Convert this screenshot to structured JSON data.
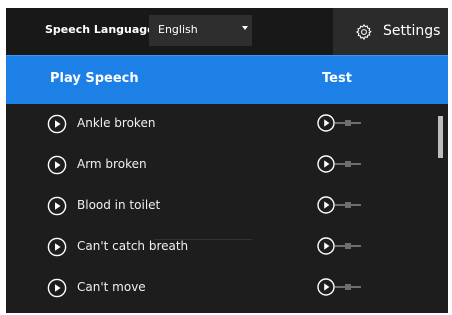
{
  "topbar": {
    "language_label": "Speech Language",
    "language_value": "English",
    "settings_label": "Settings"
  },
  "header": {
    "play_label": "Play Speech",
    "test_label": "Test"
  },
  "phrases": [
    {
      "label": "Ankle broken"
    },
    {
      "label": "Arm broken"
    },
    {
      "label": "Blood in toilet"
    },
    {
      "label": "Can't catch breath"
    },
    {
      "label": "Can't move"
    }
  ],
  "icons": {
    "settings": "gear-icon",
    "play": "play-circle-icon",
    "test": "play-with-slider-icon",
    "dropdown": "chevron-down-icon"
  },
  "colors": {
    "accent": "#1c80e6",
    "background": "#1d1d1d",
    "topbar": "#181818",
    "text": "#ffffff"
  }
}
